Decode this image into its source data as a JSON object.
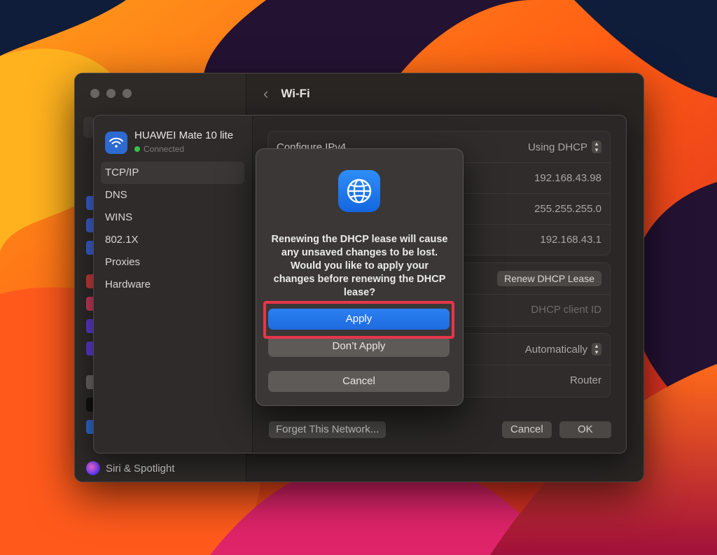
{
  "window": {
    "title": "Wi-Fi",
    "sidebar_bottom_label": "Siri & Spotlight"
  },
  "sheet": {
    "network": {
      "name": "HUAWEI Mate 10 lite",
      "status": "Connected"
    },
    "tabs": [
      {
        "label": "TCP/IP",
        "selected": true
      },
      {
        "label": "DNS"
      },
      {
        "label": "WINS"
      },
      {
        "label": "802.1X"
      },
      {
        "label": "Proxies"
      },
      {
        "label": "Hardware"
      }
    ],
    "ipv4": {
      "configure_label": "Configure IPv4",
      "configure_value": "Using DHCP",
      "ip_address": "192.168.43.98",
      "subnet_mask": "255.255.255.0",
      "router": "192.168.43.1"
    },
    "dhcp": {
      "renew_button": "Renew DHCP Lease",
      "client_id_placeholder": "DHCP client ID"
    },
    "ipv6": {
      "configure_value": "Automatically",
      "router_value": "Router"
    },
    "footer": {
      "forget_button": "Forget This Network...",
      "cancel_button": "Cancel",
      "ok_button": "OK"
    }
  },
  "alert": {
    "icon": "globe-icon",
    "message": "Renewing the DHCP lease will cause any unsaved changes to be lost. Would you like to apply your changes before renewing the DHCP lease?",
    "apply_button": "Apply",
    "dont_apply_button": "Don’t Apply",
    "cancel_button": "Cancel",
    "highlight_color": "#e8354a",
    "accent_color": "#1e6be0"
  }
}
